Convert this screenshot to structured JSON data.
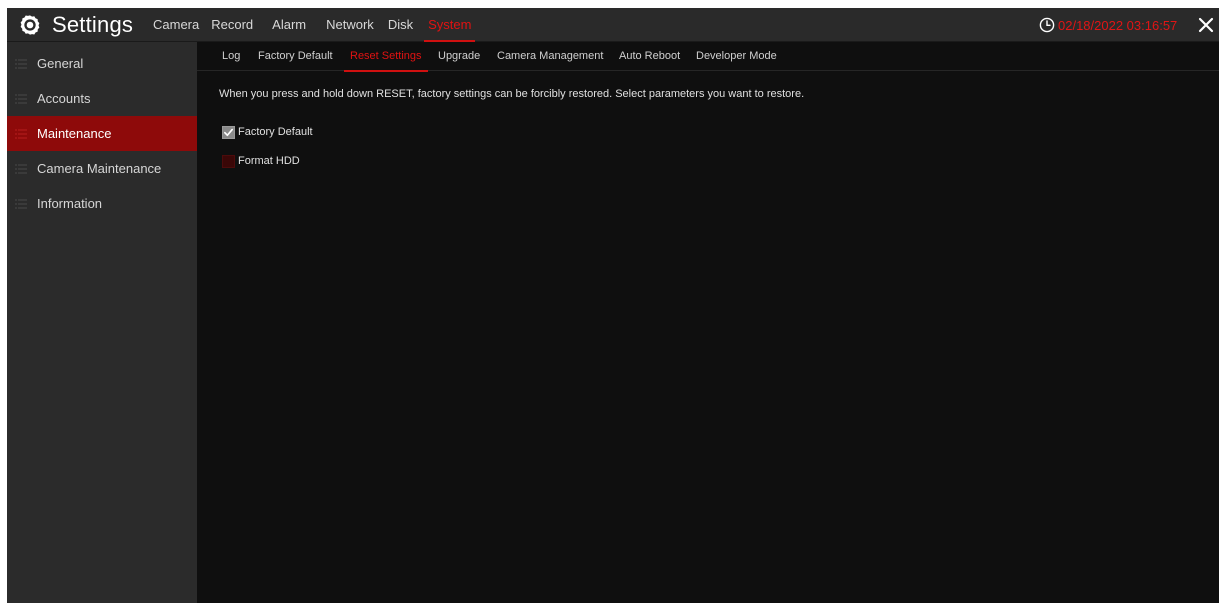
{
  "app": {
    "title": "Settings",
    "datetime": "02/18/2022 03:16:57",
    "colors": {
      "accent": "#e01212",
      "active_sidebar": "#8e0a0a",
      "topbar": "#2a2a2a",
      "sidebar": "#2b2b2b",
      "content": "#0f0f0f"
    },
    "icons": {
      "logo": "gear-icon",
      "clock": "clock-icon",
      "close": "close-icon",
      "sidebar": "list-icon",
      "check": "checkmark-icon"
    }
  },
  "main_nav": {
    "tabs": [
      {
        "label": "Camera",
        "active": false
      },
      {
        "label": "Record",
        "active": false
      },
      {
        "label": "Alarm",
        "active": false
      },
      {
        "label": "Network",
        "active": false
      },
      {
        "label": "Disk",
        "active": false
      },
      {
        "label": "System",
        "active": true
      }
    ]
  },
  "sidebar": {
    "items": [
      {
        "label": "General",
        "active": false
      },
      {
        "label": "Accounts",
        "active": false
      },
      {
        "label": "Maintenance",
        "active": true
      },
      {
        "label": "Camera Maintenance",
        "active": false
      },
      {
        "label": "Information",
        "active": false
      }
    ]
  },
  "sub_nav": {
    "tabs": [
      {
        "label": "Log",
        "active": false
      },
      {
        "label": "Factory Default",
        "active": false
      },
      {
        "label": "Reset Settings",
        "active": true
      },
      {
        "label": "Upgrade",
        "active": false
      },
      {
        "label": "Camera Management",
        "active": false
      },
      {
        "label": "Auto Reboot",
        "active": false
      },
      {
        "label": "Developer Mode",
        "active": false
      }
    ]
  },
  "content": {
    "description": "When you press and hold down RESET, factory settings can be forcibly restored. Select parameters you want to restore.",
    "options": [
      {
        "label": "Factory Default",
        "checked": true
      },
      {
        "label": "Format HDD",
        "checked": false
      }
    ]
  }
}
